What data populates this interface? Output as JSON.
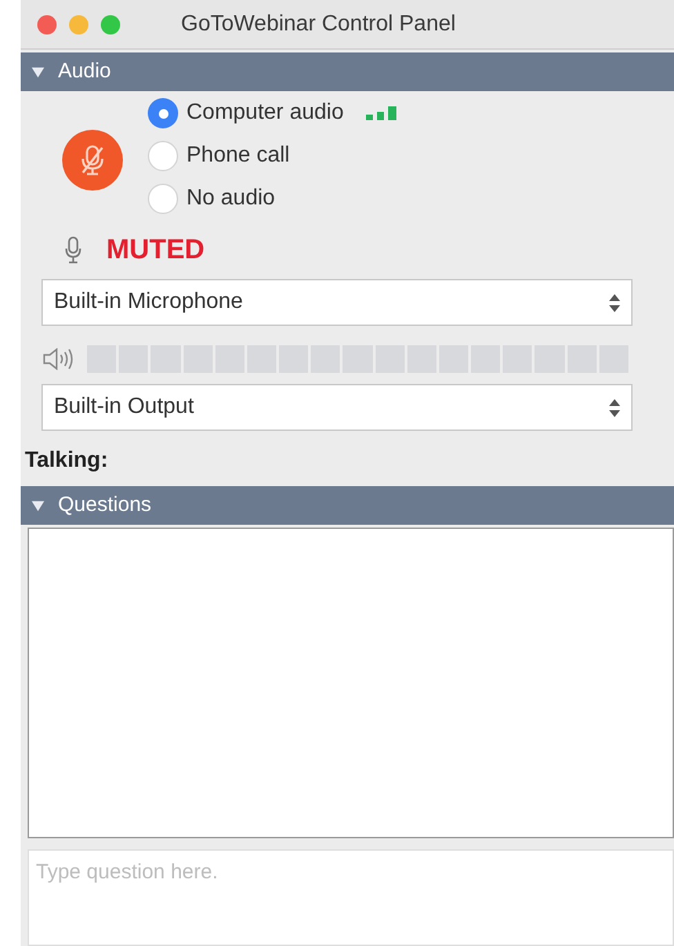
{
  "window": {
    "title": "GoToWebinar Control Panel"
  },
  "audio": {
    "header": {
      "label": "Audio",
      "expanded": true
    },
    "muted": true,
    "options": [
      {
        "label": "Computer audio",
        "selected": true
      },
      {
        "label": "Phone call",
        "selected": false
      },
      {
        "label": "No audio",
        "selected": false
      }
    ],
    "status": "MUTED",
    "microphone": {
      "value": "Built-in Microphone"
    },
    "output": {
      "value": "Built-in Output"
    },
    "talking": "Talking:"
  },
  "questions": {
    "header": {
      "label": "Questions",
      "expanded": true
    },
    "input": {
      "placeholder": "Type question here."
    }
  }
}
